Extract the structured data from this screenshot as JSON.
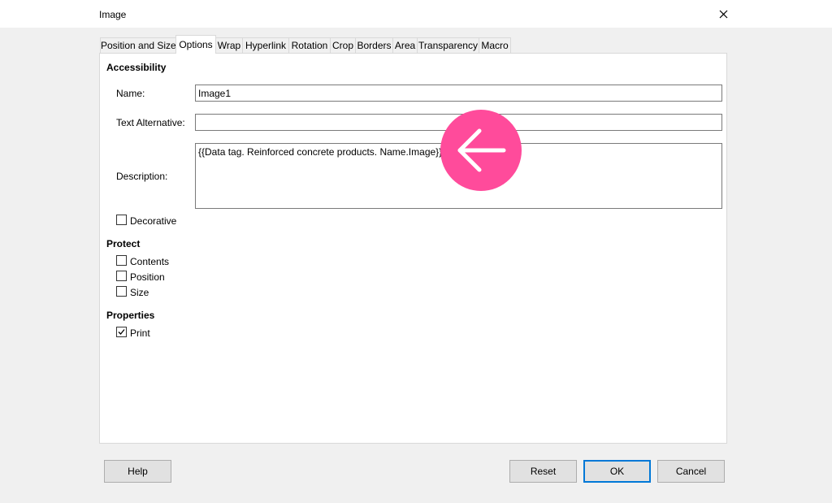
{
  "window": {
    "title": "Image"
  },
  "tabs": [
    {
      "label": "Position and Size"
    },
    {
      "label": "Options"
    },
    {
      "label": "Wrap"
    },
    {
      "label": "Hyperlink"
    },
    {
      "label": "Rotation"
    },
    {
      "label": "Crop"
    },
    {
      "label": "Borders"
    },
    {
      "label": "Area"
    },
    {
      "label": "Transparency"
    },
    {
      "label": "Macro"
    }
  ],
  "active_tab": "Options",
  "accessibility": {
    "heading": "Accessibility",
    "name_label": "Name:",
    "name_value": "Image1",
    "text_alt_label": "Text Alternative:",
    "text_alt_value": "",
    "description_label": "Description:",
    "description_value": "{{Data tag. Reinforced concrete products. Name.Image}}",
    "decorative_label": "Decorative",
    "decorative_checked": false
  },
  "protect": {
    "heading": "Protect",
    "contents_label": "Contents",
    "contents_checked": false,
    "position_label": "Position",
    "position_checked": false,
    "size_label": "Size",
    "size_checked": false
  },
  "properties": {
    "heading": "Properties",
    "print_label": "Print",
    "print_checked": true
  },
  "buttons": {
    "help": "Help",
    "reset": "Reset",
    "ok": "OK",
    "cancel": "Cancel"
  },
  "overlay": {
    "icon": "arrow-left-icon",
    "color": "#ff4b9b"
  }
}
